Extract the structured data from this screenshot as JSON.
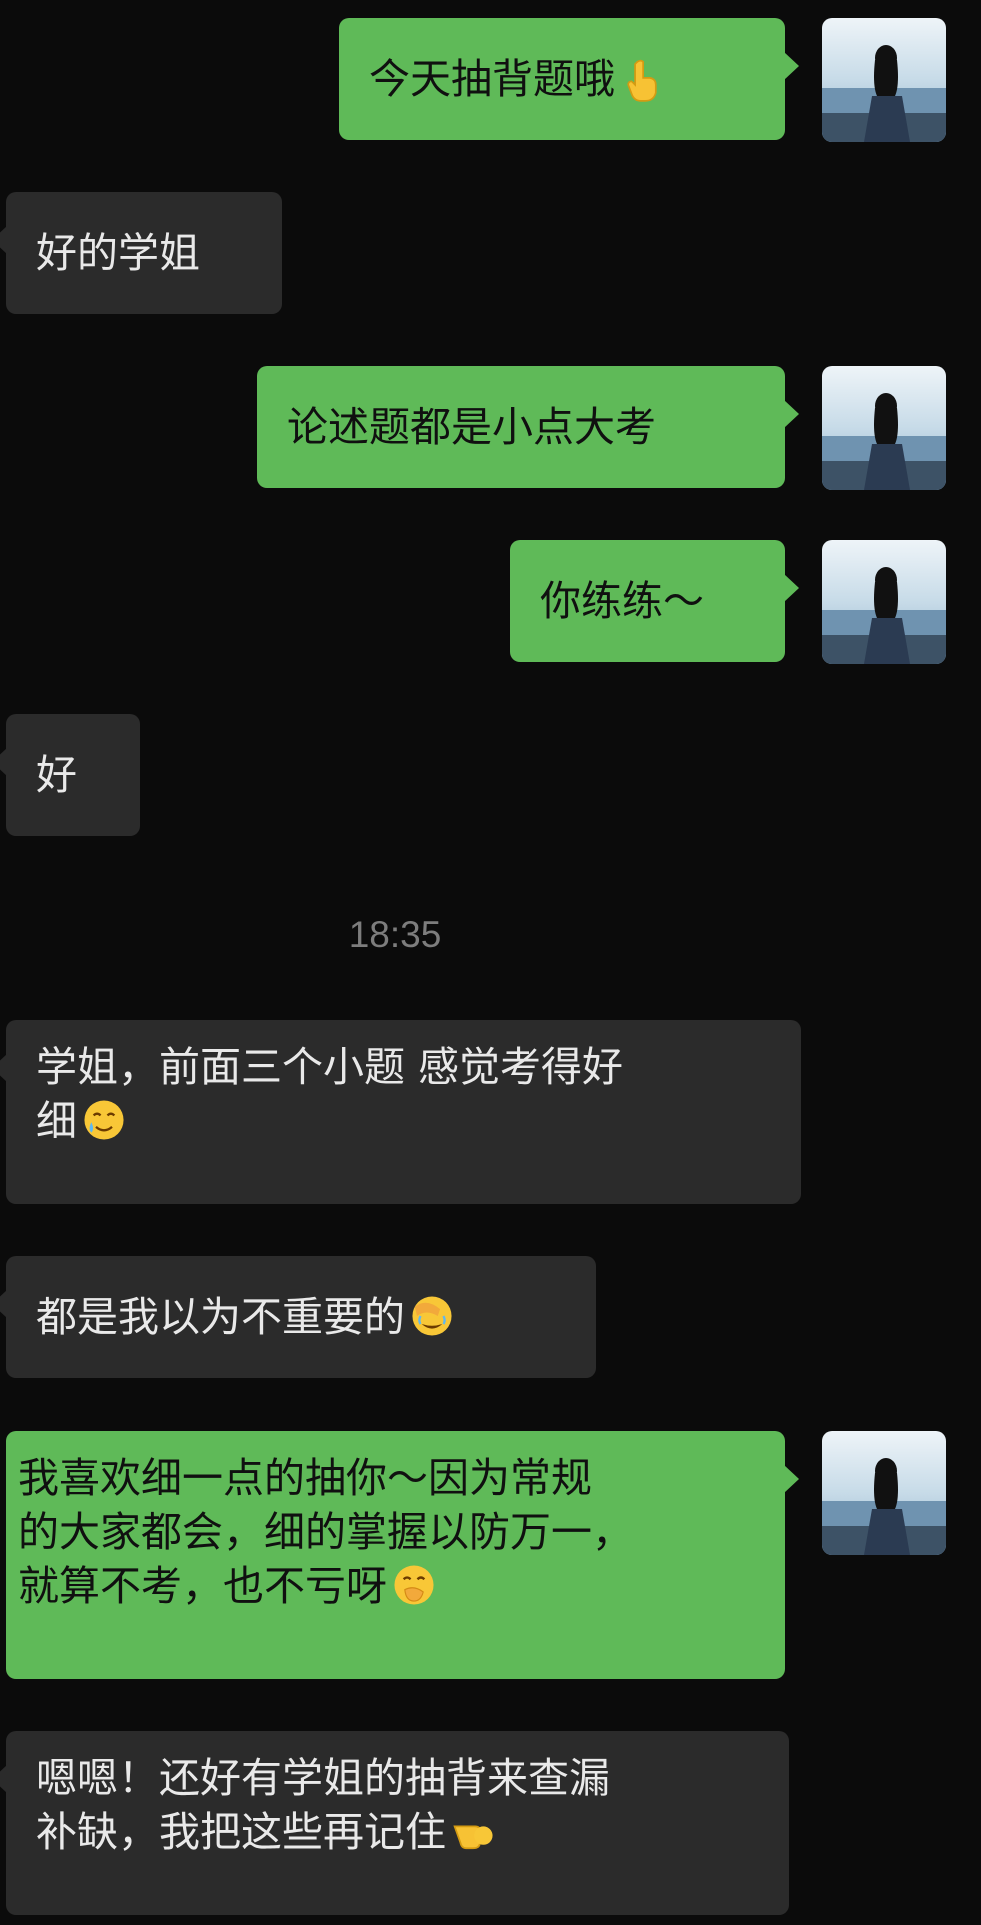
{
  "messages": [
    {
      "id": "m1",
      "sender": "self",
      "text": "今天抽背题哦",
      "emoji": "pointing-up-emoji"
    },
    {
      "id": "m2",
      "sender": "other",
      "text": "好的学姐"
    },
    {
      "id": "m3",
      "sender": "self",
      "text": "论述题都是小点大考"
    },
    {
      "id": "m4",
      "sender": "self",
      "text": "你练练～"
    },
    {
      "id": "m5",
      "sender": "other",
      "text": "好"
    },
    {
      "id": "m6",
      "sender": "other",
      "text": "学姐，前面三个小题 感觉考得好\n细",
      "emoji": "tearful-smile-emoji"
    },
    {
      "id": "m7",
      "sender": "other",
      "text": "都是我以为不重要的",
      "emoji": "facepalm-laugh-emoji"
    },
    {
      "id": "m8",
      "sender": "self",
      "text": "我喜欢细一点的抽你～因为常规\n的大家都会，细的掌握以防万一，\n就算不考，也不亏呀",
      "emoji": "hand-over-mouth-emoji"
    },
    {
      "id": "m9",
      "sender": "other",
      "text": "嗯嗯！还好有学姐的抽背来查漏\n补缺，我把这些再记住",
      "emoji": "pointing-left-emoji"
    }
  ],
  "timestamp": "18:35",
  "colors": {
    "self_bubble": "#5fba58",
    "other_bubble": "#2b2b2b",
    "background": "#0b0b0b",
    "timestamp": "#7d7d7d"
  }
}
